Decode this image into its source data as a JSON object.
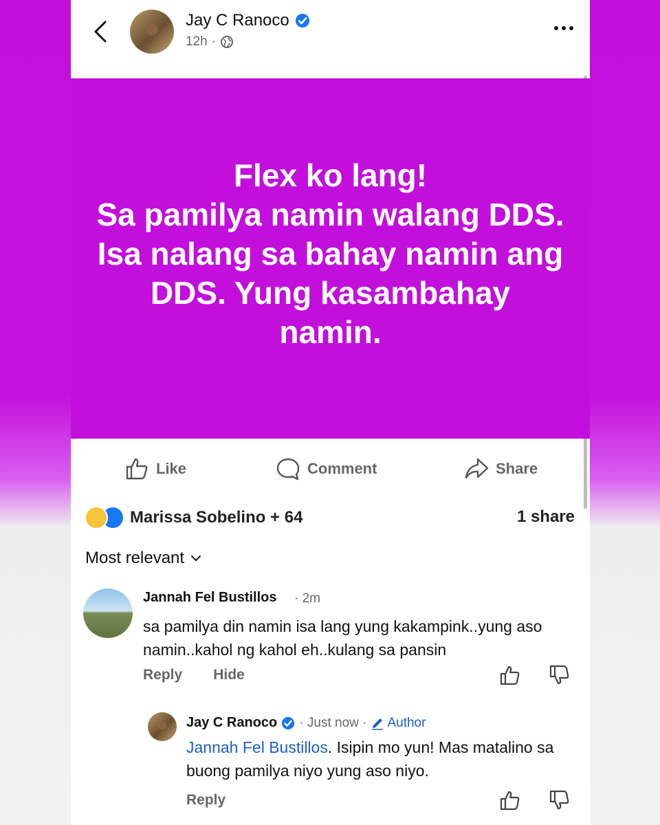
{
  "header": {
    "poster_name": "Jay C Ranoco",
    "time": "12h",
    "separator": "·",
    "icons": [
      "back-arrow-icon",
      "verified-icon",
      "globe-icon",
      "more-options-icon"
    ]
  },
  "post": {
    "text": "Flex ko lang!\nSa pamilya namin walang DDS.  Isa nalang sa bahay namin ang DDS. Yung kasambahay namin.",
    "background_color": "#c30fdc"
  },
  "actions": {
    "like": "Like",
    "comment": "Comment",
    "share": "Share"
  },
  "stats": {
    "reactors": "Marissa Sobelino + 64",
    "shares": "1 share"
  },
  "sort": {
    "label": "Most relevant"
  },
  "comments": [
    {
      "name": "Jannah Fel Bustillos",
      "time": "· 2m",
      "text": "sa pamilya din namin isa lang yung kakampink..yung aso namin..kahol ng kahol eh..kulang sa pansin",
      "reply_label": "Reply",
      "hide_label": "Hide"
    }
  ],
  "reply": {
    "name": "Jay C Ranoco",
    "time": "· Just now ·",
    "author_badge": "Author",
    "mention": "Jannah Fel Bustillos",
    "text": ". Isipin mo yun! Mas matalino sa buong pamilya niyo yung aso niyo.",
    "reply_label": "Reply"
  },
  "colors": {
    "brand_blue": "#1877f2",
    "link_blue": "#1d5ec5",
    "page_purple": "#c30fdc"
  }
}
